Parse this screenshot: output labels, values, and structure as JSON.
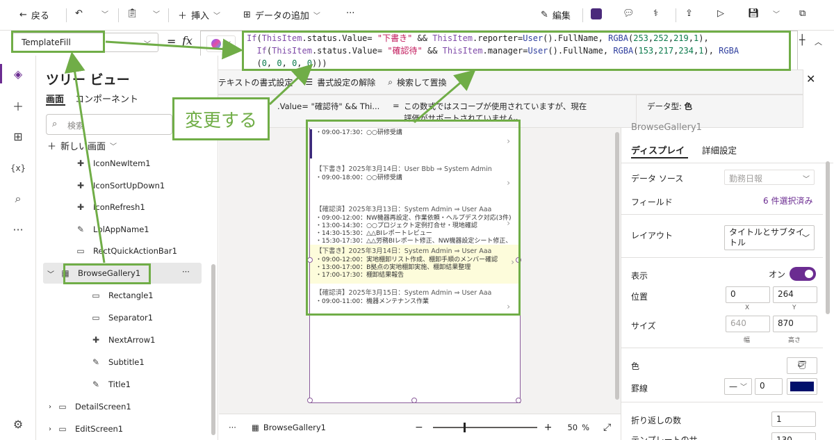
{
  "toolbar": {
    "back_label": "戻る",
    "insert_label": "挿入",
    "add_data_label": "データの追加",
    "more_label": "···",
    "edit_label": "編集"
  },
  "formula": {
    "property_value": "TemplateFill",
    "fx_label": "fx",
    "eq_label": "="
  },
  "format_bar": {
    "text_format_label": "テキストの書式設定",
    "remove_format_label": "書式設定の解除",
    "find_replace_label": "検索して置換"
  },
  "result": {
    "expr_preview": ".Value= \"確認待\" && Thi...",
    "eq": "=",
    "message_line1": "この数式ではスコープが使用されていますが、現在",
    "message_line2": "評価がサポートされていません。",
    "data_type_label": "データ型:",
    "data_type_value": "色"
  },
  "callout": {
    "text": "変更する"
  },
  "tree": {
    "title": "ツリー ビュー",
    "tab_screen": "画面",
    "tab_components": "コンポーネント",
    "search_placeholder": "検索",
    "new_screen_label": "新しい画面",
    "items": [
      {
        "label": "IconNewItem1"
      },
      {
        "label": "IconSortUpDown1"
      },
      {
        "label": "IconRefresh1"
      },
      {
        "label": "LblAppName1"
      },
      {
        "label": "RectQuickActionBar1"
      },
      {
        "label": "BrowseGallery1"
      },
      {
        "label": "Rectangle1"
      },
      {
        "label": "Separator1"
      },
      {
        "label": "NextArrow1"
      },
      {
        "label": "Subtitle1"
      },
      {
        "label": "Title1"
      },
      {
        "label": "DetailScreen1"
      },
      {
        "label": "EditScreen1"
      }
    ]
  },
  "gallery": {
    "cards": [
      {
        "title": "",
        "lines": [
          "・09:00-17:30：○○研修受講"
        ]
      },
      {
        "title": "【下書き】2025年3月14日：User Bbb ⇒ System Admin",
        "lines": [
          "・09:00-18:00：○○研修受講"
        ]
      },
      {
        "title": "【確認済】2025年3月13日：System Admin ⇒ User Aaa",
        "lines": [
          "・09:00-12:00：NW機器再設定、作業依頼・ヘルプデスク対応(3件)",
          "・13:00-14:30：○○プロジェクト定例打合せ・現地確認",
          "・14:30-15:30：△△BIレポートレビュー",
          "・15:30-17:30：△△労務BIレポート修正、NW機器設定シート修正、PC配送対応"
        ]
      },
      {
        "title": "【下書き】2025年3月14日：System Admin ⇒ User Aaa",
        "lines": [
          "・09:00-12:00：実地棚卸リスト作成、棚卸手順のメンバー確認",
          "・13:00-17:00：B拠点の実地棚卸実施、棚卸結果整理",
          "・17:00-17:30：棚卸結果報告"
        ]
      },
      {
        "title": "【確認済】2025年3月15日：System Admin ⇒ User Aaa",
        "lines": [
          "・09:00-11:00：機器メンテナンス作業"
        ]
      }
    ]
  },
  "bottombar": {
    "more": "···",
    "selected_label": "BrowseGallery1",
    "minus": "−",
    "plus": "+",
    "zoom": "50",
    "zoom_unit": "%"
  },
  "panel": {
    "title": "BrowseGallery1",
    "tab_display": "ディスプレイ",
    "tab_advanced": "詳細設定",
    "datasource_label": "データ ソース",
    "datasource_value": "勤務日報",
    "fields_label": "フィールド",
    "fields_value": "6 件選択済み",
    "layout_label": "レイアウト",
    "layout_value_1": "タイトルとサブタイ",
    "layout_value_2": "トル",
    "visible_label": "表示",
    "visible_value": "オン",
    "position_label": "位置",
    "pos_x": "0",
    "pos_y": "264",
    "x_label": "X",
    "y_label": "Y",
    "size_label": "サイズ",
    "width": "640",
    "height": "870",
    "width_label": "幅",
    "height_label": "高さ",
    "color_label": "色",
    "border_label": "罫線",
    "border_width": "0",
    "wrap_label": "折り返しの数",
    "wrap_value": "1",
    "template_label": "テンプレートのサ",
    "template_value": "130"
  },
  "colors": {
    "accent": "#70ad47",
    "toggle": "#6b2c91",
    "border_color": "#00106b",
    "highlight_card": "#fdfcdb"
  }
}
